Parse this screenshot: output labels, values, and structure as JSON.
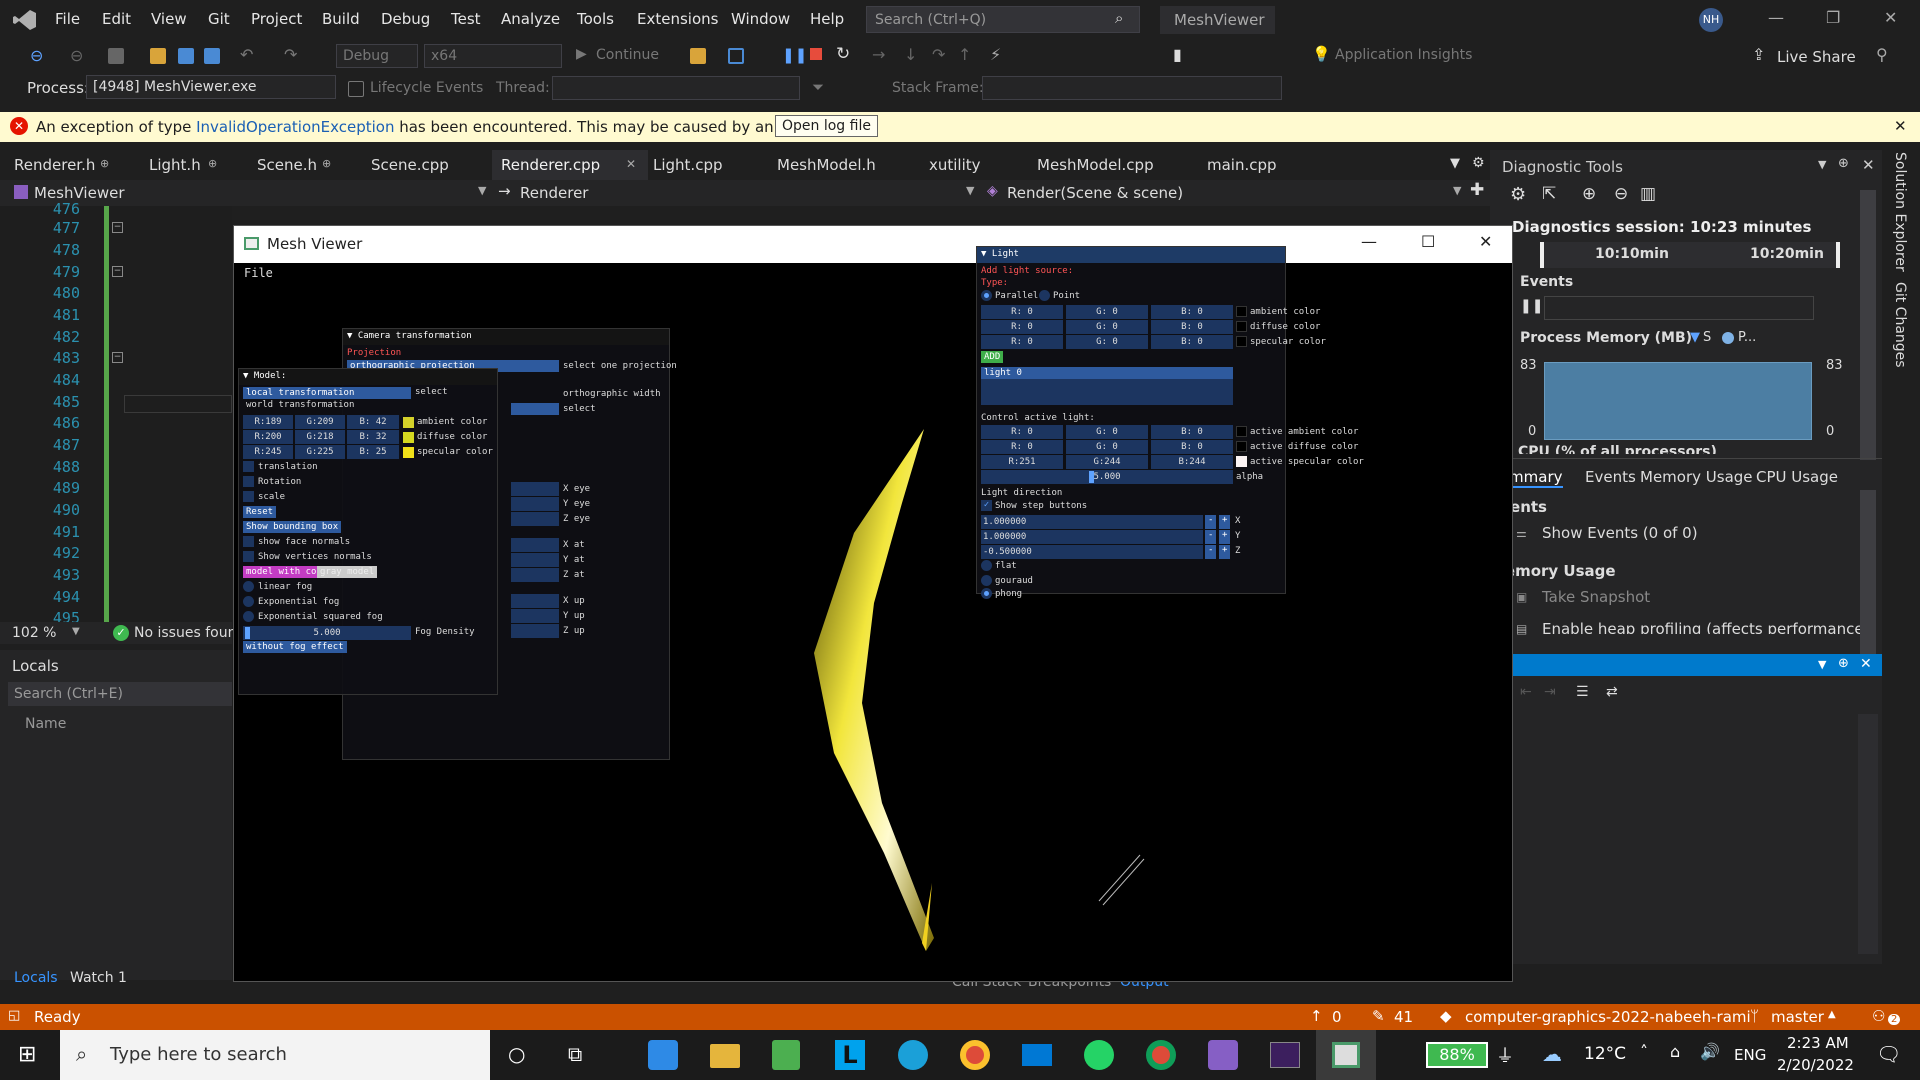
{
  "menu": [
    "File",
    "Edit",
    "View",
    "Git",
    "Project",
    "Build",
    "Debug",
    "Test",
    "Analyze",
    "Tools",
    "Extensions",
    "Window",
    "Help"
  ],
  "search": {
    "placeholder": "Search (Ctrl+Q)"
  },
  "app_title": "MeshViewer",
  "user_initials": "NH",
  "toolbar": {
    "config": "Debug",
    "platform": "x64",
    "continue": "Continue",
    "app_insights": "Application Insights",
    "live_share": "Live Share"
  },
  "procbar": {
    "process_label": "Process:",
    "process_value": "[4948] MeshViewer.exe",
    "lifecycle": "Lifecycle Events",
    "thread_label": "Thread:",
    "stackframe_label": "Stack Frame:"
  },
  "infobar": {
    "text_before": "An exception of type ",
    "exception": "InvalidOperationException",
    "text_after": " has been encountered. This may be caused by an extension.",
    "button": "Open log file"
  },
  "tabs": [
    "Renderer.h",
    "Light.h",
    "Scene.h",
    "Scene.cpp",
    "Renderer.cpp",
    "Light.cpp",
    "MeshModel.h",
    "xutility",
    "MeshModel.cpp",
    "main.cpp"
  ],
  "navbar": {
    "project": "MeshViewer",
    "class": "Renderer",
    "member": "Render(Scene & scene)"
  },
  "line_numbers": [
    "476",
    "477",
    "478",
    "479",
    "480",
    "481",
    "482",
    "483",
    "484",
    "485",
    "486",
    "487",
    "488",
    "489",
    "490",
    "491",
    "492",
    "493",
    "494",
    "495"
  ],
  "editor_status": {
    "zoom": "102 %",
    "issues": "No issues found"
  },
  "locals": {
    "title": "Locals",
    "search_placeholder": "Search (Ctrl+E)",
    "col_name": "Name",
    "tab_locals": "Locals",
    "tab_watch": "Watch 1"
  },
  "diag": {
    "title": "Diagnostic Tools",
    "session": "Diagnostics session: 10:23 minutes",
    "t1": "10:10min",
    "t2": "10:20min",
    "events": "Events",
    "process_memory": "Process Memory (MB)",
    "legend_s": "S",
    "legend_p": "P...",
    "mem_max": "83",
    "mem_min": "0",
    "cpu": "CPU (% of all processors)",
    "tabs": [
      "Summary",
      "Events",
      "Memory Usage",
      "CPU Usage"
    ],
    "events_hdr": "Events",
    "show_events": "Show Events (0 of 0)",
    "memory_hdr": "Memory Usage",
    "take_snapshot": "Take Snapshot",
    "heap": "Enable heap profiling (affects performance)"
  },
  "right_strip": [
    "Solution Explorer",
    "Git Changes"
  ],
  "bottom_tabs": [
    "Call Stack",
    "Breakpoints",
    "Output"
  ],
  "status": {
    "ready": "Ready",
    "up": "0",
    "edits": "41",
    "repo": "computer-graphics-2022-nabeeh-rami",
    "branch": "master",
    "notif": "2"
  },
  "taskbar": {
    "search": "Type here to search",
    "battery": "88%",
    "temp": "12°C",
    "lang": "ENG",
    "time": "2:23 AM",
    "date": "2/20/2022"
  },
  "mesh_viewer": {
    "title": "Mesh Viewer",
    "menu": "File",
    "camera": {
      "header": "Camera transformation",
      "projection": "Projection",
      "proj_value": "orthographic projection",
      "select_one": "select one projection",
      "ortho_width": "orthographic width",
      "select": "select",
      "eye": [
        "X eye",
        "Y eye",
        "Z eye"
      ],
      "at": [
        "X at",
        "Y at",
        "Z at"
      ],
      "up": [
        "X up",
        "Y up",
        "Z up"
      ]
    },
    "model": {
      "header": "Model:",
      "local": "local transformation",
      "world": "world transformation",
      "select": "select",
      "rows": [
        [
          "R:189",
          "G:209",
          "B: 42",
          "ambient color",
          "#d4d12a"
        ],
        [
          "R:200",
          "G:218",
          "B: 32",
          "diffuse color",
          "#d4d820"
        ],
        [
          "R:245",
          "G:225",
          "B: 25",
          "specular color",
          "#f0e019"
        ]
      ],
      "translation": "translation",
      "rotation": "Rotation",
      "scale": "scale",
      "reset": "Reset",
      "bbox": "Show bounding box",
      "face_normals": "show face normals",
      "vertex_normals": "Show vertices normals",
      "model_colors": "model with colors",
      "gray_model": "gray model",
      "linear_fog": "linear fog",
      "exp_fog": "Exponential fog",
      "exp2_fog": "Exponential squared fog",
      "fog_density_val": "5.000",
      "fog_density": "Fog Density",
      "no_fog": "without fog effect"
    },
    "light": {
      "header": "Light",
      "add": "Add light source:",
      "type": "Type:",
      "parallel": "Parallel",
      "point": "Point",
      "rows": [
        [
          "R: 0",
          "G: 0",
          "B: 0",
          "ambient color"
        ],
        [
          "R: 0",
          "G: 0",
          "B: 0",
          "diffuse color"
        ],
        [
          "R: 0",
          "G: 0",
          "B: 0",
          "specular color"
        ]
      ],
      "add_btn": "ADD",
      "list_item": "light 0",
      "control": "Control active light:",
      "active_rows": [
        [
          "R: 0",
          "G: 0",
          "B: 0",
          "active ambient color",
          "#000000"
        ],
        [
          "R: 0",
          "G: 0",
          "B: 0",
          "active diffuse color",
          "#000000"
        ],
        [
          "R:251",
          "G:244",
          "B:244",
          "active specular color",
          "#fbf4f4"
        ]
      ],
      "alpha_val": "5.000",
      "alpha": "alpha",
      "direction": "Light direction",
      "step": "Show step buttons",
      "dir": [
        [
          "1.000000",
          "X"
        ],
        [
          "1.000000",
          "Y"
        ],
        [
          "-0.500000",
          "Z"
        ]
      ],
      "flat": "flat",
      "gouraud": "gouraud",
      "phong": "phong"
    }
  }
}
